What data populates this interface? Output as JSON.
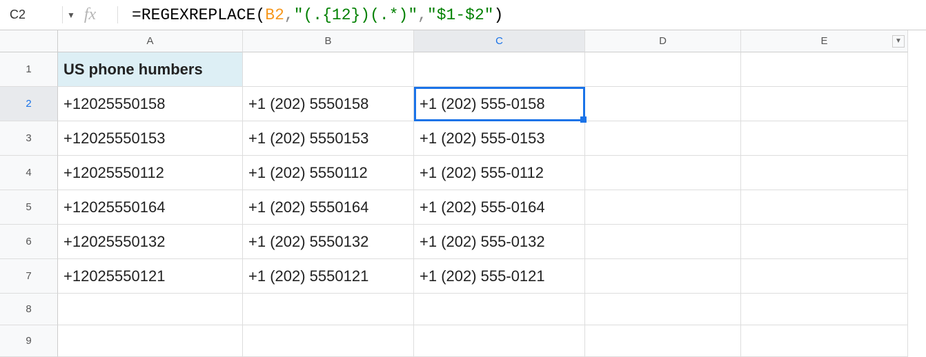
{
  "nameBox": "C2",
  "formula": {
    "fn": "REGEXREPLACE",
    "ref": "B2",
    "arg2": "\"(.{12})(.*)\"",
    "arg3": "\"$1-$2\""
  },
  "columns": [
    "A",
    "B",
    "C",
    "D",
    "E"
  ],
  "rows": [
    "1",
    "2",
    "3",
    "4",
    "5",
    "6",
    "7",
    "8",
    "9"
  ],
  "selectedCell": "C2",
  "data": {
    "A1": "US phone humbers",
    "A2": "+12025550158",
    "B2": "+1 (202) 5550158",
    "C2": "+1 (202) 555-0158",
    "A3": "+12025550153",
    "B3": "+1 (202) 5550153",
    "C3": "+1 (202) 555-0153",
    "A4": "+12025550112",
    "B4": "+1 (202) 5550112",
    "C4": "+1 (202) 555-0112",
    "A5": "+12025550164",
    "B5": "+1 (202) 5550164",
    "C5": "+1 (202) 555-0164",
    "A6": "+12025550132",
    "B6": "+1 (202) 5550132",
    "C6": "+1 (202) 555-0132",
    "A7": "+12025550121",
    "B7": "+1 (202) 5550121",
    "C7": "+1 (202) 555-0121"
  }
}
